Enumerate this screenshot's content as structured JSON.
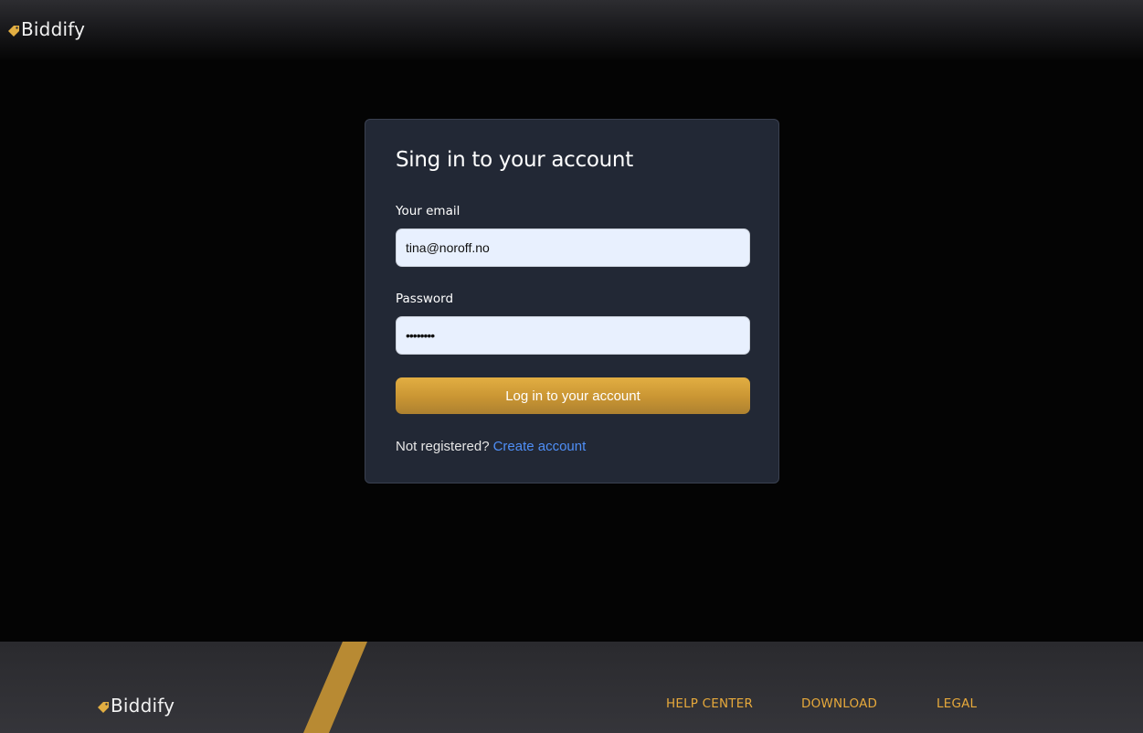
{
  "brand": {
    "name": "Biddify",
    "icon": "tag-icon",
    "accent_color": "#e2ae42"
  },
  "login": {
    "title": "Sing in to your account",
    "email_label": "Your email",
    "email_value": "tina@noroff.no",
    "password_label": "Password",
    "password_value": "••••••••",
    "submit_label": "Log in to your account",
    "register_prompt": "Not registered?",
    "register_link": "Create account"
  },
  "footer": {
    "links": [
      "HELP CENTER",
      "DOWNLOAD",
      "LEGAL"
    ]
  },
  "colors": {
    "page_background": "#040404",
    "card_background": "#222835",
    "input_background": "#e8f0fe",
    "link_blue": "#4f8ff7",
    "footer_link": "#e7a93b"
  }
}
